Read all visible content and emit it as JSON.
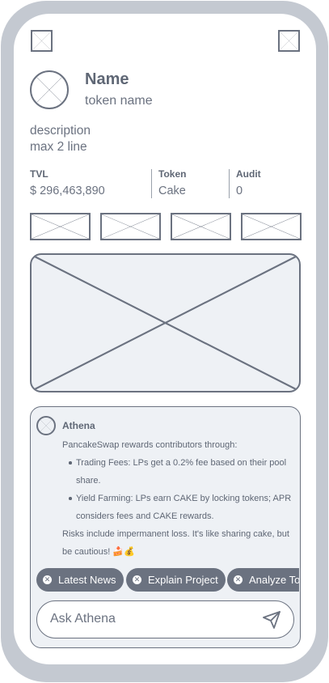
{
  "profile": {
    "name": "Name",
    "token_name": "token name",
    "description_line1": "description",
    "description_line2": "max 2 line"
  },
  "stats": [
    {
      "label": "TVL",
      "value": "$ 296,463,890"
    },
    {
      "label": "Token",
      "value": "Cake"
    },
    {
      "label": "Audit",
      "value": "0"
    }
  ],
  "chat": {
    "bot_name": "Athena",
    "intro": "PancakeSwap rewards contributors through:",
    "bullets": [
      "Trading Fees: LPs get a 0.2% fee based on their pool share.",
      "Yield Farming: LPs earn CAKE by locking tokens; APR considers fees and CAKE rewards."
    ],
    "outro": "Risks include impermanent loss. It's like sharing cake, but be cautious! 🍰💰",
    "chips": [
      "Latest News",
      "Explain Project",
      "Analyze Token"
    ],
    "input_placeholder": "Ask Athena"
  },
  "colors": {
    "frame": "#c4c9d1",
    "stroke": "#6b7280",
    "panel": "#eef1f5"
  },
  "icons": [
    "placeholder-image-icon",
    "avatar-placeholder-icon",
    "close-circle-icon",
    "send-icon"
  ]
}
